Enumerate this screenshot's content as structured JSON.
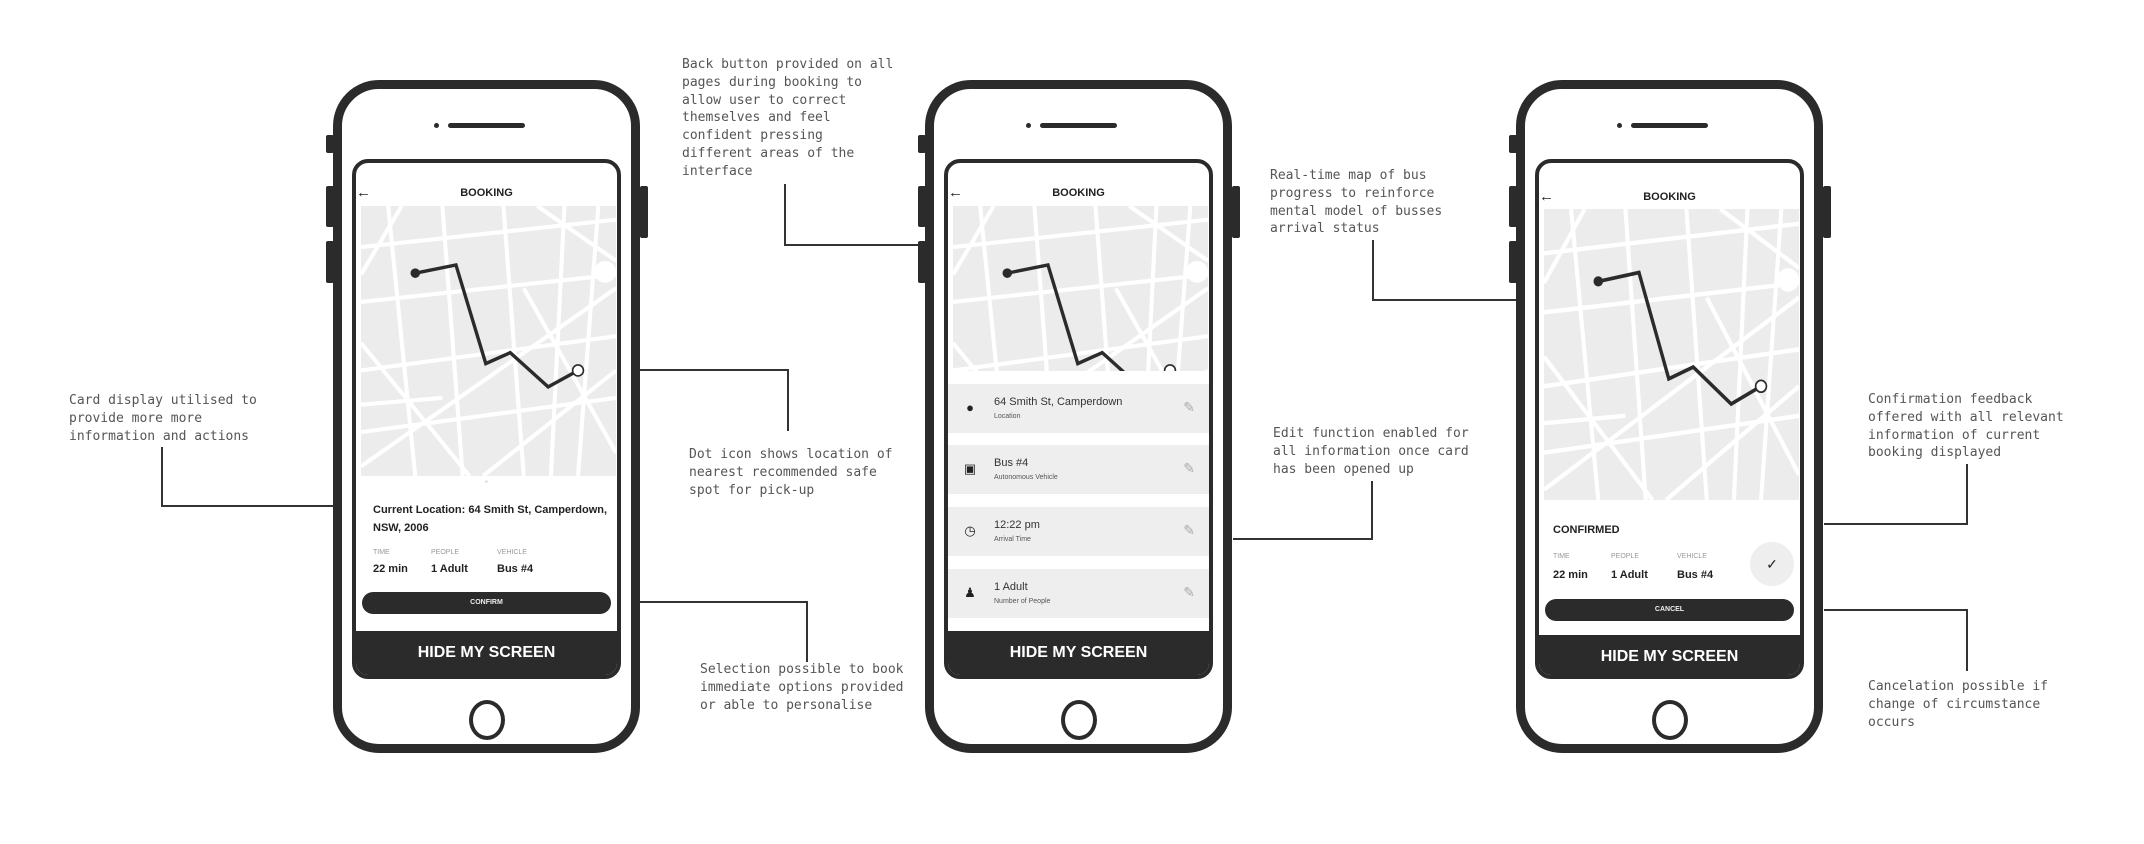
{
  "annotations": {
    "card": "Card display utilised to\nprovide more more\ninformation and actions",
    "back": "Back button provided on all\npages during booking to\nallow user to correct\nthemselves and feel\nconfident pressing\ndifferent areas of the\ninterface",
    "dot": "Dot icon shows location of\nnearest recommended safe\nspot for pick-up",
    "selection": "Selection possible to book\nimmediate options provided\nor able to personalise",
    "realtime": "Real-time map of bus\nprogress to reinforce\nmental model of busses\narrival status",
    "edit": "Edit function enabled for\nall information once card\nhas been opened up",
    "confirmation": "Confirmation feedback\noffered with all relevant\ninformation of current\nbooking displayed",
    "cancel": "Cancelation possible if\nchange of circumstance\noccurs"
  },
  "screen1": {
    "title": "BOOKING",
    "back_icon": "arrow-left",
    "location": "Current Location: 64 Smith St, Camperdown, NSW, 2006",
    "labels": [
      "TIME",
      "PEOPLE",
      "VEHICLE"
    ],
    "values": [
      "22 min",
      "1 Adult",
      "Bus #4"
    ],
    "confirm": "CONFIRM",
    "hide": "HIDE MY SCREEN"
  },
  "screen2": {
    "title": "BOOKING",
    "items": [
      {
        "icon": "location-pin",
        "title": "64 Smith St, Camperdown",
        "subtitle": "Location"
      },
      {
        "icon": "car",
        "title": "Bus #4",
        "subtitle": "Autonomous Vehicle"
      },
      {
        "icon": "clock",
        "title": "12:22 pm",
        "subtitle": "Arrival Time"
      },
      {
        "icon": "person",
        "title": "1 Adult",
        "subtitle": "Number of People"
      }
    ],
    "hide": "HIDE MY SCREEN"
  },
  "screen3": {
    "title": "BOOKING",
    "status": "CONFIRMED",
    "labels": [
      "TIME",
      "PEOPLE",
      "VEHICLE"
    ],
    "values": [
      "22 min",
      "1 Adult",
      "Bus #4"
    ],
    "cancel": "CANCEL",
    "hide": "HIDE MY SCREEN"
  },
  "colors": {
    "phone": "#2b2b2b",
    "map": "#ececec"
  }
}
